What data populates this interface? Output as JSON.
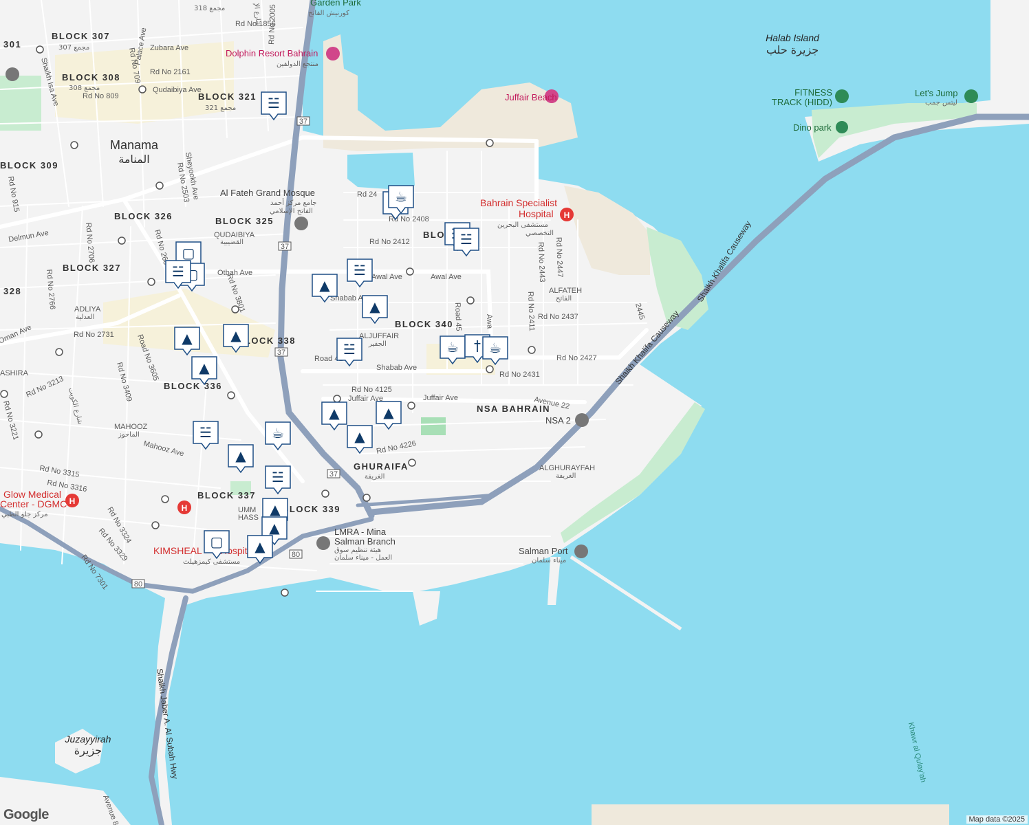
{
  "map": {
    "attribution": "Map data ©2025",
    "logo_text": "Google",
    "colors": {
      "water": "#8edcf0",
      "land": "#f3f3f3",
      "sand": "#efe9dc",
      "park": "#c8ecd0",
      "highway": "#8ea0bb",
      "marker": "#1f4f86"
    }
  },
  "labels": {
    "city": "Manama",
    "city_ar": "المنامة",
    "islands": {
      "halab": "Halab Island",
      "halab_ar": "جزيرة حلب",
      "juzayyirah": "Juzayyirah",
      "juzayyirah_ar": "جزيرة"
    },
    "water": {
      "khawr": "Khawr al Qulay'ah"
    },
    "blocks": {
      "b301": "301",
      "b307": "BLOCK 307",
      "b307_sub": "307 مجمع",
      "b308": "BLOCK 308",
      "b308_sub": "308 مجمع",
      "b321": "BLOCK 321",
      "b321_sub": "321 مجمع",
      "b318": "318 مجمع",
      "b309": "BLOCK 309",
      "b326": "BLOCK 326",
      "b325": "BLOCK 325",
      "b327": "BLOCK 327",
      "b328": "328",
      "b338": "BLOCK 338",
      "b340": "BLOCK 340",
      "b336": "BLOCK 336",
      "b337": "BLOCK 337",
      "b339": "BLOCK 339",
      "blo": "BLO",
      "nsa": "NSA BAHRAIN",
      "ghuraifa": "GHURAIFA",
      "ghuraifa_ar": "الغريفة"
    },
    "neighborhoods": {
      "qudaibiya": "QUDAIBIYA",
      "qudaibiya_ar": "القضيبية",
      "adliya": "ADLIYA",
      "adliya_ar": "العدلية",
      "aljuffair": "ALJUFFAIR",
      "aljuffair_ar": "الجفير",
      "mahooz": "MAHOOZ",
      "mahooz_ar": "الماحوز",
      "alfateh": "ALFATEH",
      "alfateh_ar": "الفاتح",
      "alghurayfah": "ALGHURAYFAH",
      "alghurayfah_ar": "الغريفة",
      "umm_hassam": "UMM",
      "umm_hassam2": "HASS",
      "bushiria": "ASHIRA"
    },
    "roads": {
      "zubara": "Zubara Ave",
      "palace": "Palace Ave",
      "qudaibiya_ave": "Qudaibiya Ave",
      "rd2161": "Rd No 2161",
      "rd809": "Rd No 809",
      "rd1856": "Rd No 1856",
      "rd2005": "Rd No 2005",
      "rd709": "Rd No 709",
      "shaikh_isa": "Shaikh Isa Ave",
      "sheyookh": "Sheyookh Ave",
      "rd2503": "Rd No 2503",
      "rd915": "Rd No 915",
      "delmun": "Delmun Ave",
      "rd2706": "Rd No 2706",
      "rd2766": "Rd No 2766",
      "rd260": "Rd No 260",
      "otbah": "Otbah Ave",
      "rd3801": "Rd No 3801",
      "rd2731": "Rd No 2731",
      "oman": "Oman Ave",
      "road3605": "Road No 3605",
      "rd3409": "Rd No 3409",
      "rd3213": "Rd No 3213",
      "rd3221": "Rd No 3221",
      "mahooz_ave": "Mahooz Ave",
      "rd3315": "Rd No 3315",
      "rd3316": "Rd No 3316",
      "rd3324": "Rd No 3324",
      "rd3329": "Rd No 3329",
      "rd7301": "Rd No 7301",
      "rd2408": "Rd No 2408",
      "rd24": "Rd 24",
      "rd2412": "Rd No 2412",
      "awal": "Awal Ave",
      "awal2": "Awal Ave",
      "shabab": "Shabab Ave",
      "shabab2": "Shabab Ave",
      "road45": "Road 45",
      "awa": "Awa",
      "road41": "Road 41",
      "rd4125": "Rd No 4125",
      "juffair": "Juffair Ave",
      "juffair2": "Juffair Ave",
      "rd4226": "Rd No 4226",
      "rd2427": "Rd No 2427",
      "rd2431": "Rd No 2431",
      "rd2437": "Rd No 2437",
      "rd2411": "Rd No 2411",
      "rd2443": "Rd No 2443",
      "rd2447": "Rd No 2447",
      "r2445": "2445",
      "avenue22": "Avenue 22",
      "avenue80": "Avenue 80",
      "kuwait_ar": "شارع الكويت",
      "causeway": "Shaikh Khalifa Causeway",
      "causeway2": "Shaikh Khalifa Causeway",
      "jaber": "Shaikh Jaber A. Al Subah Hwy",
      "hwy37a": "37",
      "hwy37b": "37",
      "hwy37c": "37",
      "hwy37d": "37",
      "hwy80a": "80",
      "hwy80b": "80",
      "rd_ar": "شارع الإ"
    },
    "pois": {
      "garden_park": "Garden Park",
      "garden_park_ar": "كورنيش الفاتح",
      "dolphin": "Dolphin Resort Bahrain",
      "dolphin_ar": "منتجع الدولفين",
      "juffair_beach": "Juffair Beach",
      "fateh_mosque": "Al Fateh Grand Mosque",
      "fateh_mosque_ar": "جامع مركز أحمد",
      "fateh_mosque_ar2": "الفاتح الإسلامي",
      "bsh": "Bahrain Specialist",
      "bsh2": "Hospital",
      "bsh_ar": "مستشفى البحرين",
      "bsh_ar2": "التخصصي",
      "fitness": "FITNESS",
      "fitness2": "TRACK (HIDD)",
      "lets_jump": "Let's Jump",
      "lets_jump_ar": "ليتس جمب",
      "dino": "Dino park",
      "nsa2": "NSA 2",
      "lmra": "LMRA - Mina",
      "lmra2": "Salman Branch",
      "lmra_ar": "هيئة تنظيم سوق",
      "lmra_ar2": "العمل - ميناء سلمان",
      "salman_port": "Salman Port",
      "salman_port_ar": "ميناء سلمان",
      "glow": "Glow Medical",
      "glow2": "Center - DGMC",
      "glow_ar": "مركز جلو الطبي",
      "kims": "KIMSHEAL",
      "kims2": "Hospita",
      "kims_ar": "مستشفى كيمزهيلث"
    },
    "markers": [
      {
        "icon": "cart"
      },
      {
        "icon": "coffee"
      },
      {
        "icon": "coffee"
      },
      {
        "icon": "cart"
      },
      {
        "icon": "cart"
      },
      {
        "icon": "bag"
      },
      {
        "icon": "bag"
      },
      {
        "icon": "cart"
      },
      {
        "icon": "school"
      },
      {
        "icon": "school"
      },
      {
        "icon": "cart"
      },
      {
        "icon": "school"
      },
      {
        "icon": "school"
      },
      {
        "icon": "school"
      },
      {
        "icon": "coffee"
      },
      {
        "icon": "food"
      },
      {
        "icon": "coffee"
      },
      {
        "icon": "school"
      },
      {
        "icon": "school"
      },
      {
        "icon": "school"
      },
      {
        "icon": "cart"
      },
      {
        "icon": "coffee"
      },
      {
        "icon": "cart"
      },
      {
        "icon": "school"
      },
      {
        "icon": "cart"
      },
      {
        "icon": "school"
      },
      {
        "icon": "school"
      },
      {
        "icon": "bag"
      },
      {
        "icon": "school"
      }
    ]
  }
}
